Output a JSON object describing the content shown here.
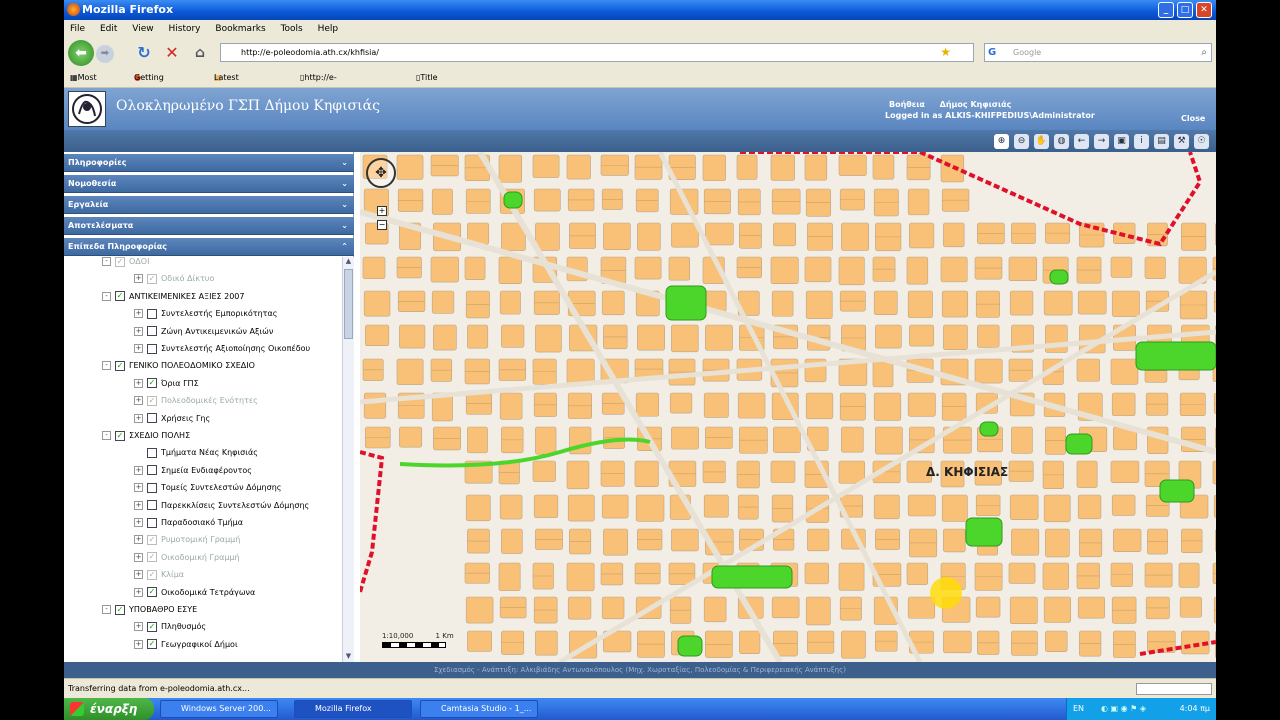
{
  "window": {
    "title": "Mozilla Firefox"
  },
  "menu": [
    "File",
    "Edit",
    "View",
    "History",
    "Bookmarks",
    "Tools",
    "Help"
  ],
  "nav": {
    "url": "http://e-poleodomia.ath.cx/khfisia/",
    "search_placeholder": "Google"
  },
  "bookmarks": [
    "Most Visited",
    "Getting Started",
    "Latest Headlines",
    "http://e-poleodomia.a...",
    "Title Clips in Camtasia"
  ],
  "app": {
    "title": "Ολοκληρωμένο ΓΣΠ Δήμου Κηφισιάς",
    "help_link": "Βοήθεια",
    "municipality_link": "Δήμος Κηφισιάς",
    "logged_in": "Logged in as ALKIS-KHIFPEDIUS\\Administrator",
    "close_link": "Close"
  },
  "sidebar": {
    "panels": [
      "Πληροφορίες",
      "Νομοθεσία",
      "Εργαλεία",
      "Αποτελέσματα",
      "Επίπεδα Πληροφορίας"
    ]
  },
  "tree": [
    {
      "label": "ΟΔΟΙ",
      "level": 0,
      "checked": true,
      "dim": true,
      "expand": "-"
    },
    {
      "label": "Οδικό Δίκτυο",
      "level": 1,
      "checked": true,
      "dim": true,
      "expand": "+"
    },
    {
      "label": "ΑΝΤΙΚΕΙΜΕΝΙΚΕΣ ΑΞΙΕΣ 2007",
      "level": 0,
      "checked": true,
      "dim": false,
      "expand": "-"
    },
    {
      "label": "Συντελεστής Εμπορικότητας",
      "level": 1,
      "checked": false,
      "dim": false,
      "expand": "+"
    },
    {
      "label": "Ζώνη Αντικειμενικών Αξιών",
      "level": 1,
      "checked": false,
      "dim": false,
      "expand": "+"
    },
    {
      "label": "Συντελεστής Αξιοποίησης Οικοπέδου",
      "level": 1,
      "checked": false,
      "dim": false,
      "expand": "+"
    },
    {
      "label": "ΓΕΝΙΚΟ ΠΟΛΕΟΔΟΜΙΚΟ ΣΧΕΔΙΟ",
      "level": 0,
      "checked": true,
      "dim": false,
      "expand": "-"
    },
    {
      "label": "Όρια ΓΠΣ",
      "level": 1,
      "checked": true,
      "dim": false,
      "expand": "+"
    },
    {
      "label": "Πολεοδομικές Ενότητες",
      "level": 1,
      "checked": true,
      "dim": true,
      "expand": "+"
    },
    {
      "label": "Χρήσεις Γης",
      "level": 1,
      "checked": false,
      "dim": false,
      "expand": "+"
    },
    {
      "label": "ΣΧΕΔΙΟ ΠΟΛΗΣ",
      "level": 0,
      "checked": true,
      "dim": false,
      "expand": "-"
    },
    {
      "label": "Τμήματα Νέας Κηφισιάς",
      "level": 1,
      "checked": false,
      "dim": false,
      "expand": ""
    },
    {
      "label": "Σημεία Ενδιαφέροντος",
      "level": 1,
      "checked": false,
      "dim": false,
      "expand": "+"
    },
    {
      "label": "Τομείς Συντελεστών Δόμησης",
      "level": 1,
      "checked": false,
      "dim": false,
      "expand": "+"
    },
    {
      "label": "Παρεκκλίσεις Συντελεστών Δόμησης",
      "level": 1,
      "checked": false,
      "dim": false,
      "expand": "+"
    },
    {
      "label": "Παραδοσιακό Τμήμα",
      "level": 1,
      "checked": false,
      "dim": false,
      "expand": "+"
    },
    {
      "label": "Ρυμοτομική Γραμμή",
      "level": 1,
      "checked": true,
      "dim": true,
      "expand": "+"
    },
    {
      "label": "Οικοδομική Γραμμή",
      "level": 1,
      "checked": true,
      "dim": true,
      "expand": "+"
    },
    {
      "label": "Κλίμα",
      "level": 1,
      "checked": true,
      "dim": true,
      "expand": "+"
    },
    {
      "label": "Οικοδομικά Τετράγωνα",
      "level": 1,
      "checked": true,
      "dim": false,
      "expand": "+"
    },
    {
      "label": "ΥΠΟΒΑΘΡΟ ΕΣΥΕ",
      "level": 0,
      "checked": true,
      "dim": false,
      "expand": "-"
    },
    {
      "label": "Πληθυσμός",
      "level": 1,
      "checked": true,
      "dim": false,
      "expand": "+"
    },
    {
      "label": "Γεωγραφικοί Δήμοι",
      "level": 1,
      "checked": true,
      "dim": false,
      "expand": "+"
    }
  ],
  "map": {
    "label": "Δ. ΚΗΦΙΣΙΑΣ",
    "scale_text": "1:10,000",
    "scale_unit": "1 Km",
    "block_color": "#F9C077",
    "park_color": "#4CD52B",
    "boundary_color": "#E0102B"
  },
  "footer": "Σχεδιασμός - Ανάπτυξη: Αλκιβιάδης Αντωνακόπουλος (Μηχ. Χωροταξίας, Πολεοδομίας & Περιφερειακής Ανάπτυξης)",
  "status": "Transferring data from e-poleodomia.ath.cx...",
  "taskbar": {
    "start": "έναρξη",
    "tasks": [
      "Windows Server 200...",
      "Mozilla Firefox",
      "Camtasia Studio - 1_..."
    ],
    "lang": "EN",
    "time": "4:04 πμ"
  }
}
